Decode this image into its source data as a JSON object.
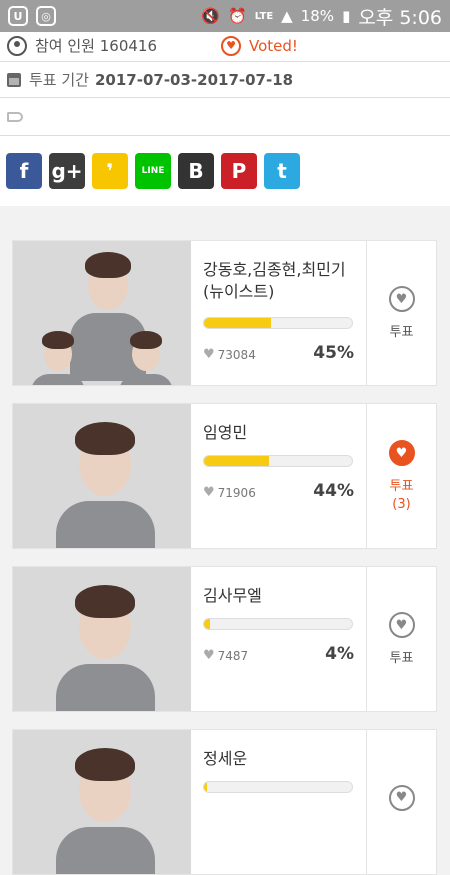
{
  "status_bar": {
    "battery": "18%",
    "network": "LTE",
    "time": "오후 5:06"
  },
  "header": {
    "participants_label": "참여 인원 160416",
    "voted_label": "Voted!",
    "period_label": "투표 기간",
    "period_value": "2017-07-03-2017-07-18"
  },
  "share_icons": [
    {
      "name": "facebook",
      "glyph": "f",
      "color": "#3b5998"
    },
    {
      "name": "google-plus",
      "glyph": "g+",
      "color": "#3d3d3d"
    },
    {
      "name": "kakaostory",
      "glyph": "❜",
      "color": "#f7c600"
    },
    {
      "name": "line",
      "glyph": "LINE",
      "color": "#00c300"
    },
    {
      "name": "band",
      "glyph": "B",
      "color": "#333333"
    },
    {
      "name": "pinterest",
      "glyph": "P",
      "color": "#cb2027"
    },
    {
      "name": "twitter",
      "glyph": "t",
      "color": "#2da9e1"
    }
  ],
  "candidates": [
    {
      "name": "강동호,김종현,최민기 (뉴이스트)",
      "votes": "73084",
      "percent": "45%",
      "fill": 0.45,
      "vote_label": "투표",
      "voted": false,
      "my_votes": ""
    },
    {
      "name": "임영민",
      "votes": "71906",
      "percent": "44%",
      "fill": 0.44,
      "vote_label": "투표",
      "voted": true,
      "my_votes": "(3)"
    },
    {
      "name": "김사무엘",
      "votes": "7487",
      "percent": "4%",
      "fill": 0.04,
      "vote_label": "투표",
      "voted": false,
      "my_votes": ""
    },
    {
      "name": "정세운",
      "votes": "",
      "percent": "",
      "fill": 0.02,
      "vote_label": "",
      "voted": false,
      "my_votes": ""
    }
  ]
}
